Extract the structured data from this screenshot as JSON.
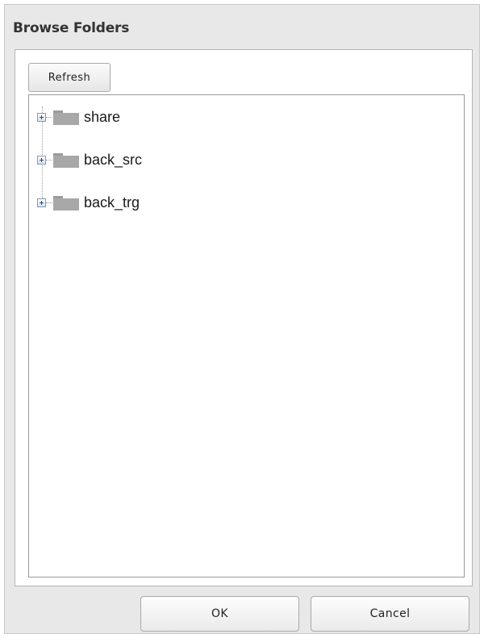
{
  "dialog": {
    "title": "Browse Folders"
  },
  "toolbar": {
    "refresh_label": "Refresh"
  },
  "tree": {
    "items": [
      {
        "label": "share",
        "icon": "folder-icon",
        "collapsed": true
      },
      {
        "label": "back_src",
        "icon": "folder-icon",
        "collapsed": true
      },
      {
        "label": "back_trg",
        "icon": "folder-icon",
        "collapsed": true
      }
    ]
  },
  "footer": {
    "ok_label": "OK",
    "cancel_label": "Cancel"
  },
  "colors": {
    "dialog_background": "#e8e8e8",
    "folder": "#a8a8a8",
    "expander_border": "#7f9db9"
  }
}
